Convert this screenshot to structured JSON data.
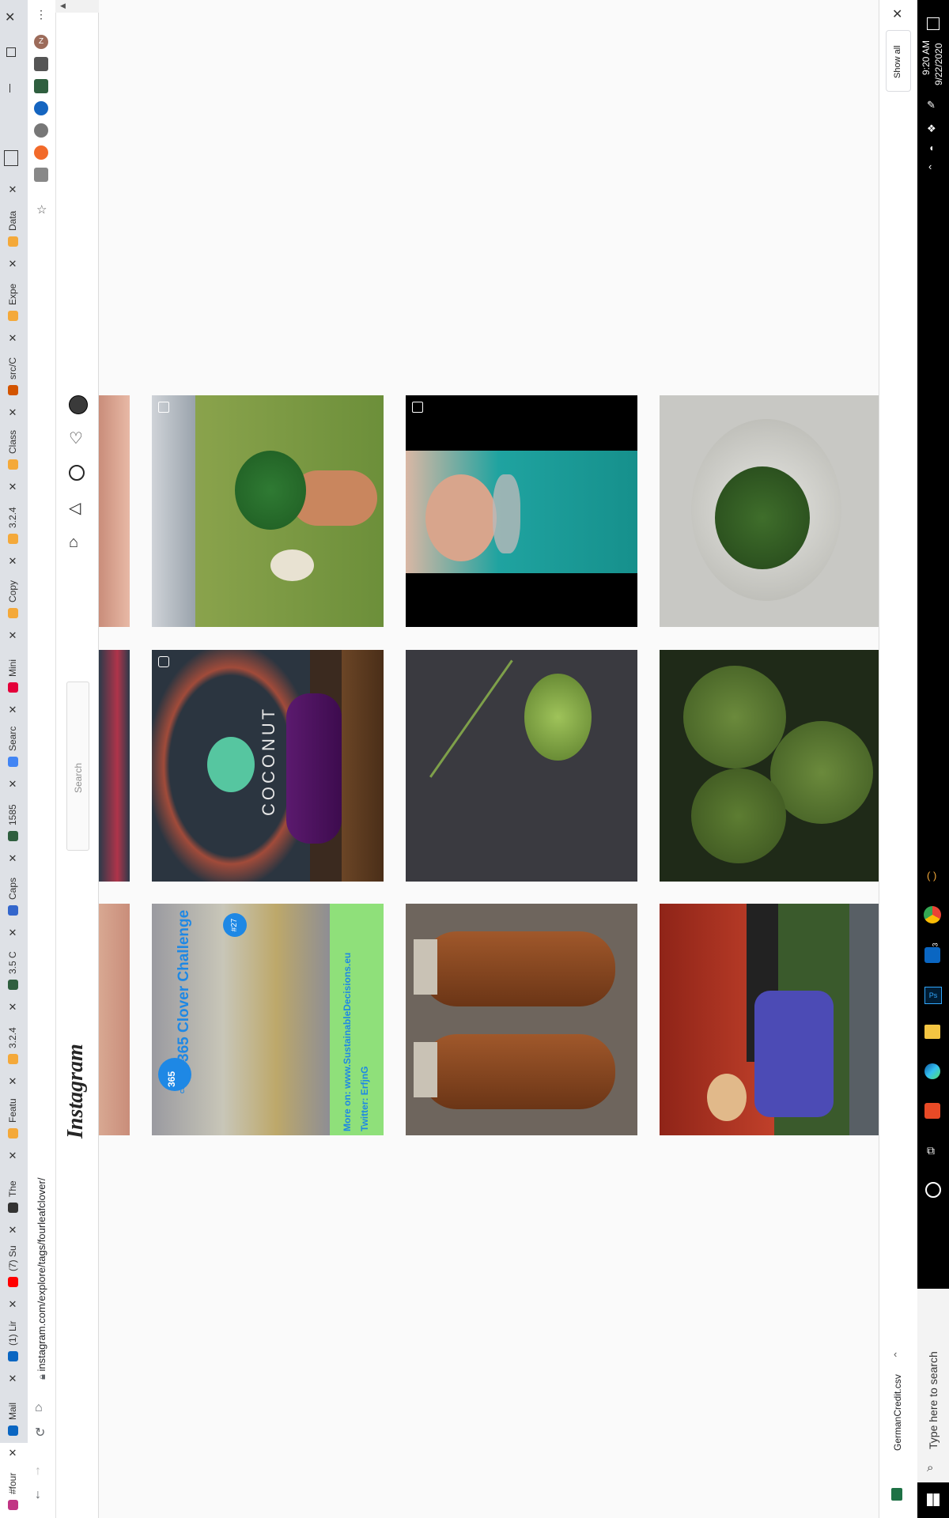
{
  "browser": {
    "url": "instagram.com/explore/tags/fourleafclover/",
    "tabs": [
      {
        "label": "#four",
        "color": "#c13584"
      },
      {
        "label": "Mail",
        "color": "#0a66c2"
      },
      {
        "label": "(1) Lir",
        "color": "#0a66c2"
      },
      {
        "label": "(7) Su",
        "color": "#ff0000"
      },
      {
        "label": "The",
        "color": "#333333"
      },
      {
        "label": "Featu",
        "color": "#f4a93a"
      },
      {
        "label": "3.2.4",
        "color": "#f4a93a"
      },
      {
        "label": "3.5 C",
        "color": "#2f5f3f"
      },
      {
        "label": "Caps",
        "color": "#3366cc"
      },
      {
        "label": "1585",
        "color": "#2f5f3f"
      },
      {
        "label": "Searc",
        "color": "#4285f4"
      },
      {
        "label": "Mini",
        "color": "#e4003a"
      },
      {
        "label": "Copy",
        "color": "#f4a93a"
      },
      {
        "label": "3.2.4",
        "color": "#f4a93a"
      },
      {
        "label": "Class",
        "color": "#f4a93a"
      },
      {
        "label": "src/C",
        "color": "#d35400"
      },
      {
        "label": "Expe",
        "color": "#f4a93a"
      },
      {
        "label": "Data",
        "color": "#f4a93a"
      }
    ]
  },
  "instagram": {
    "logo": "Instagram",
    "search_placeholder": "Search"
  },
  "downloads": {
    "file_name": "GermanCredit.csv",
    "show_all": "Show all"
  },
  "taskbar": {
    "search_placeholder": "Type here to search",
    "time": "9:20 AM",
    "date": "9/22/2020",
    "mail_badge": "3"
  },
  "posts": [
    {
      "caption_title": "365 Clover Challenge",
      "caption_site": "More on: www.SustainableDecisions.eu",
      "caption_twitter": "Twitter: ErfjnG",
      "badge": "365",
      "badge_sub": "CHALLENGE",
      "number": "#27"
    },
    {
      "sign_top": "COCONUT"
    }
  ]
}
